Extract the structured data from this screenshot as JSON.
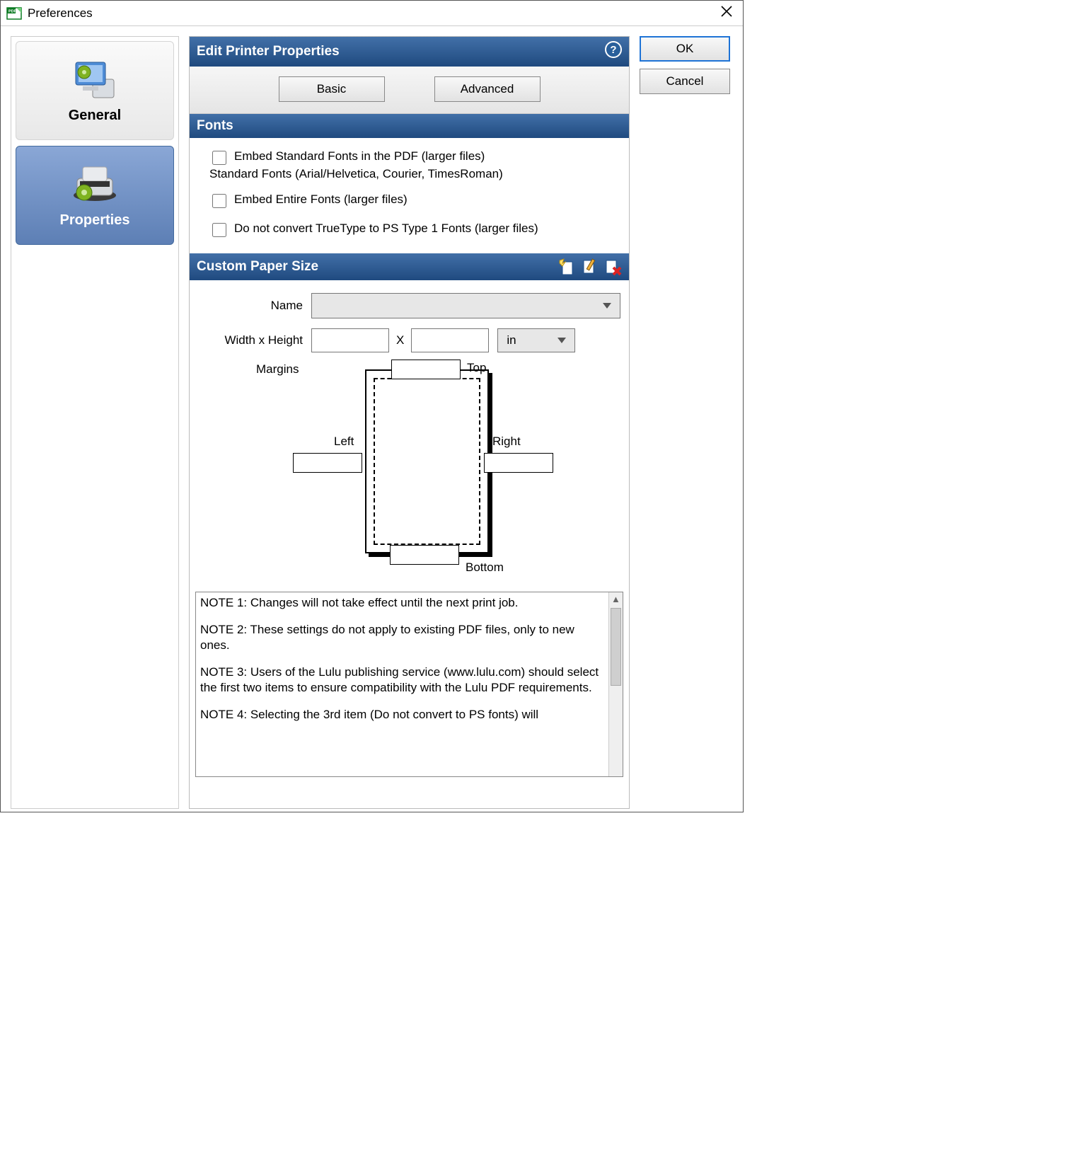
{
  "window": {
    "title": "Preferences"
  },
  "sidebar": {
    "items": [
      {
        "label": "General"
      },
      {
        "label": "Properties"
      }
    ]
  },
  "header": {
    "title": "Edit Printer Properties"
  },
  "tabs": {
    "basic": "Basic",
    "advanced": "Advanced"
  },
  "fonts": {
    "header": "Fonts",
    "embed_standard": "Embed Standard Fonts in the PDF (larger files)",
    "standard_sub": "Standard Fonts (Arial/Helvetica, Courier, TimesRoman)",
    "embed_entire": "Embed Entire Fonts (larger files)",
    "no_convert": "Do not convert TrueType to PS Type 1 Fonts (larger files)"
  },
  "paper": {
    "header": "Custom Paper Size",
    "name_label": "Name",
    "wh_label": "Width x Height",
    "x": "X",
    "unit": "in",
    "margins_label": "Margins",
    "top": "Top",
    "left": "Left",
    "right": "Right",
    "bottom": "Bottom"
  },
  "notes": {
    "n1": "NOTE 1: Changes will not take effect until the next print job.",
    "n2": "NOTE 2: These settings do not apply to existing PDF files, only to new ones.",
    "n3": "NOTE 3: Users of the Lulu publishing service (www.lulu.com) should select the first two items to ensure compatibility with the Lulu PDF requirements.",
    "n4": "NOTE 4: Selecting the 3rd item (Do not convert to PS fonts) will"
  },
  "buttons": {
    "ok": "OK",
    "cancel": "Cancel"
  }
}
